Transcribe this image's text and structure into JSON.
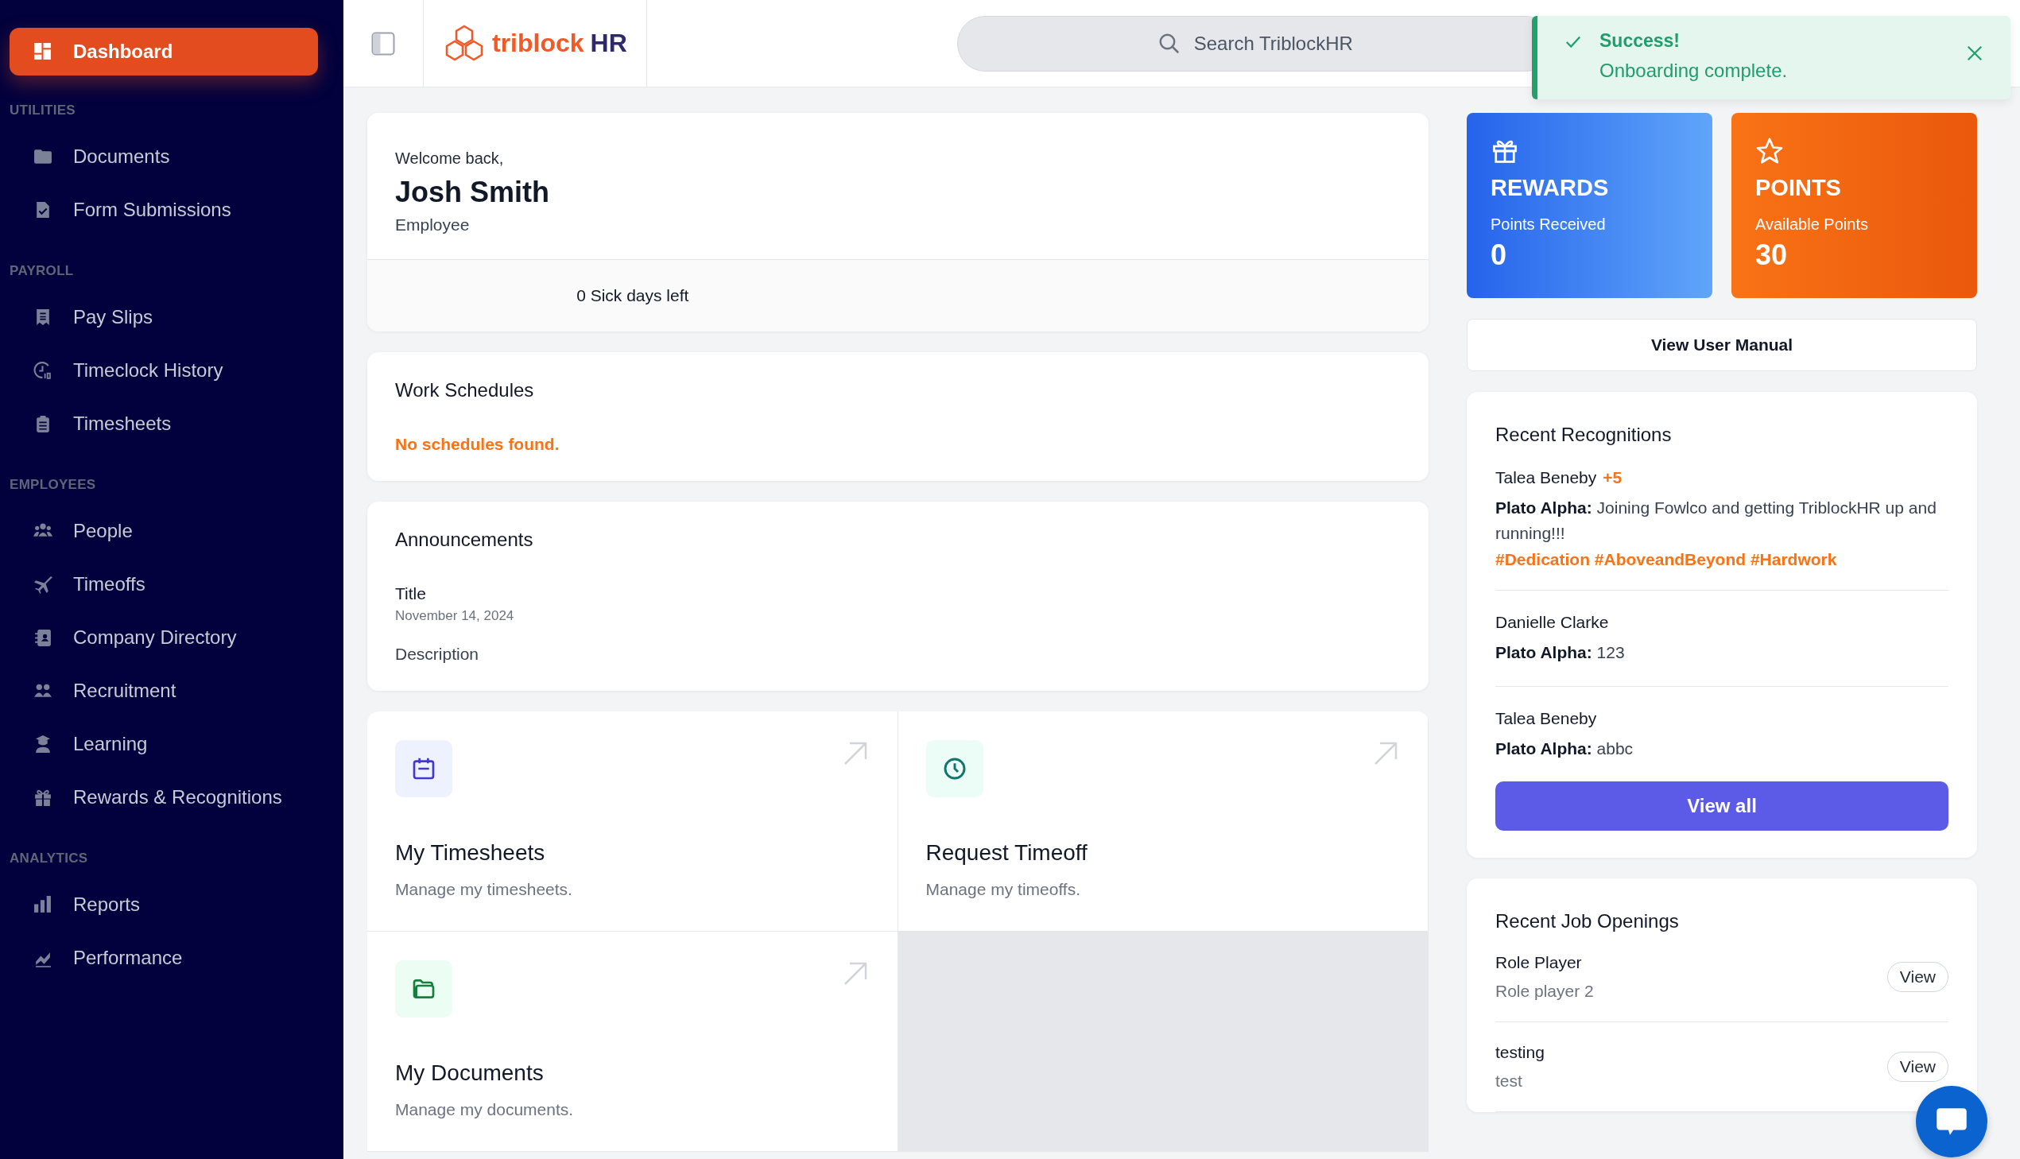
{
  "sidebar": {
    "items": [
      {
        "kind": "link",
        "label": "Dashboard",
        "selected": true
      },
      {
        "kind": "section",
        "label": "UTILITIES"
      },
      {
        "kind": "link",
        "label": "Documents",
        "selected": false
      },
      {
        "kind": "link",
        "label": "Form Submissions",
        "selected": false
      },
      {
        "kind": "section",
        "label": "PAYROLL"
      },
      {
        "kind": "link",
        "label": "Pay Slips",
        "selected": false
      },
      {
        "kind": "link",
        "label": "Timeclock History",
        "selected": false
      },
      {
        "kind": "link",
        "label": "Timesheets",
        "selected": false
      },
      {
        "kind": "section",
        "label": "EMPLOYEES"
      },
      {
        "kind": "link",
        "label": "People",
        "selected": false
      },
      {
        "kind": "link",
        "label": "Timeoffs",
        "selected": false
      },
      {
        "kind": "link",
        "label": "Company Directory",
        "selected": false
      },
      {
        "kind": "link",
        "label": "Recruitment",
        "selected": false
      },
      {
        "kind": "link",
        "label": "Learning",
        "selected": false
      },
      {
        "kind": "link",
        "label": "Rewards & Recognitions",
        "selected": false
      },
      {
        "kind": "section",
        "label": "ANALYTICS"
      },
      {
        "kind": "link",
        "label": "Reports",
        "selected": false
      },
      {
        "kind": "link",
        "label": "Performance",
        "selected": false
      }
    ]
  },
  "header": {
    "logo_main": "triblock",
    "logo_accent": "HR",
    "search": {
      "placeholder": "Search TriblockHR"
    }
  },
  "toast": {
    "title": "Success!",
    "message": "Onboarding complete."
  },
  "welcome": {
    "greeting": "Welcome back,",
    "name": "Josh Smith",
    "role": "Employee",
    "sick_days": "0 Sick days left"
  },
  "work_schedules": {
    "title": "Work Schedules",
    "empty": "No schedules found."
  },
  "announcements": {
    "title": "Announcements",
    "items": [
      {
        "title": "Title",
        "date": "November 14, 2024",
        "description": "Description"
      }
    ]
  },
  "quick_links": [
    {
      "title": "My Timesheets",
      "description": "Manage my timesheets."
    },
    {
      "title": "Request Timeoff",
      "description": "Manage my timeoffs."
    },
    {
      "title": "My Documents",
      "description": "Manage my documents."
    }
  ],
  "stats": [
    {
      "kind": "rewards",
      "title": "REWARDS",
      "label": "Points Received",
      "value": "0"
    },
    {
      "kind": "points",
      "title": "POINTS",
      "label": "Available Points",
      "value": "30"
    }
  ],
  "manual_button": "View User Manual",
  "recognitions": {
    "title": "Recent Recognitions",
    "items": [
      {
        "name": "Talea Beneby",
        "points": "+5",
        "message": "**Plato Alpha:** Joining Fowlco and getting TriblockHR up and running!!!",
        "tags": "#Dedication #AboveandBeyond #Hardwork"
      },
      {
        "name": "Danielle Clarke",
        "message": "**Plato Alpha:** 123"
      },
      {
        "name": "Talea Beneby",
        "message": "**Plato Alpha:** abbc"
      }
    ],
    "button": "View all"
  },
  "jobs": {
    "title": "Recent Job Openings",
    "items": [
      {
        "title": "Role Player",
        "subtitle": "Role player 2",
        "button": "View"
      },
      {
        "title": "testing",
        "subtitle": "test",
        "button": "View"
      }
    ]
  }
}
